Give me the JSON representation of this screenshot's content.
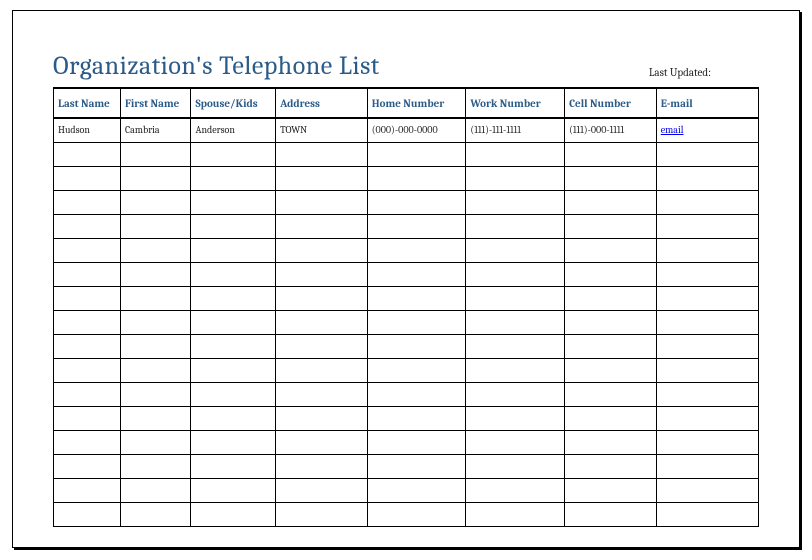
{
  "title": "Organization's Telephone List",
  "last_updated_label": "Last Updated:",
  "columns": {
    "last_name": "Last Name",
    "first_name": "First Name",
    "spouse_kids": "Spouse/Kids",
    "address": "Address",
    "home_number": "Home Number",
    "work_number": "Work Number",
    "cell_number": "Cell Number",
    "email": "E-mail"
  },
  "rows": [
    {
      "last_name": "Hudson",
      "first_name": "Cambria",
      "spouse_kids": "Anderson",
      "address": "TOWN",
      "home_number": "(000)-000-0000",
      "work_number": "(111)-111-1111",
      "cell_number": "(111)-000-1111",
      "email": "email"
    }
  ],
  "empty_row_count": 16
}
